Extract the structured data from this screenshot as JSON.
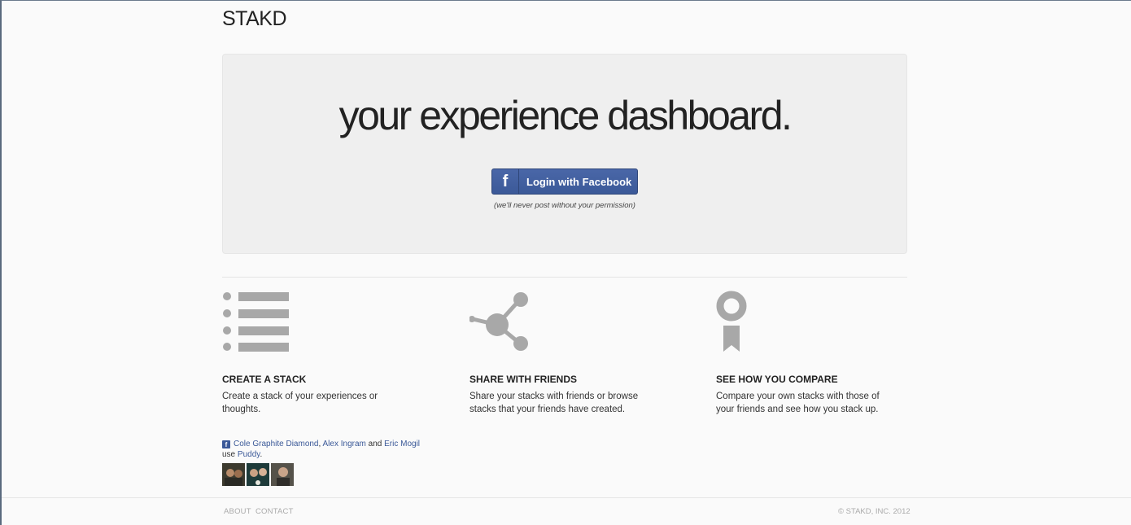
{
  "brand": {
    "logo": "STAKD"
  },
  "hero": {
    "title": "your experience dashboard.",
    "login_label": "Login with Facebook",
    "facebook_glyph": "f",
    "permission_note": "(we'll never post without your permission)"
  },
  "features": [
    {
      "title": "CREATE A STACK",
      "description": "Create a stack of your experiences or thoughts.",
      "icon": "list-icon"
    },
    {
      "title": "SHARE WITH FRIENDS",
      "description": "Share your stacks with friends or browse stacks that your friends have created.",
      "icon": "share-icon"
    },
    {
      "title": "SEE HOW YOU COMPARE",
      "description": "Compare your own stacks with those of your friends and see how you stack up.",
      "icon": "ribbon-icon"
    }
  ],
  "friends": {
    "names": [
      "Cole Graphite Diamond",
      "Alex Ingram",
      "Eric Mogil"
    ],
    "separator": ",",
    "conjunction": "and",
    "use_text": "use",
    "app_name": "Puddy",
    "period": "."
  },
  "footer": {
    "links": [
      "ABOUT",
      "CONTACT"
    ],
    "copyright": "© STAKD, INC. 2012"
  },
  "colors": {
    "facebook_blue": "#3b5998",
    "icon_gray": "#a8a8a8",
    "hero_bg": "#efefef"
  }
}
